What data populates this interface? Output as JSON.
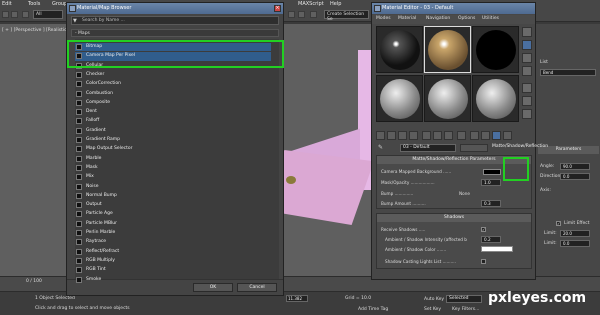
{
  "app": {
    "menubar": [
      {
        "label": "Edit"
      },
      {
        "label": "Tools"
      },
      {
        "label": "Group"
      },
      {
        "label": "MAXScript"
      },
      {
        "label": "Help"
      }
    ],
    "selection_filter": "All",
    "selection_set_placeholder": "Create Selection Se",
    "viewport_label": "[ + ] [Perspective ] [Realistic ]",
    "timeline": {
      "frame_readout": "0 / 100"
    },
    "status": {
      "objects_selected": "1 Object Selected",
      "prompt": "Click and drag to select and move objects",
      "y_value": "11.382",
      "grid": "Grid = 10.0",
      "add_time_tag": "Add Time Tag",
      "auto_key": "Auto Key",
      "auto_key_value": "Selected",
      "set_key": "Set Key",
      "key_filters": "Key Filters..."
    },
    "command_panel": {
      "list_label": "List",
      "bend_label": "Bend",
      "parameters_header": "Parameters",
      "angle_label": "Angle:",
      "angle_value": "90.0",
      "direction_label": "Direction:",
      "direction_value": "0.0",
      "axis_label": "Axis:",
      "limit_effect_label": "Limit Effect",
      "upper_limit_label": "Limit:",
      "upper_limit_value": "20.0",
      "lower_limit_label": "Limit:",
      "lower_limit_value": "0.0"
    }
  },
  "browser": {
    "title": "Material/Map Browser",
    "search_placeholder": "Search by Name ...",
    "group_label": "- Maps",
    "items": [
      {
        "label": "Bitmap",
        "selected": true
      },
      {
        "label": "Camera Map Per Pixel",
        "selected": true
      },
      {
        "label": "Cellular",
        "selected": false
      },
      {
        "label": "Checker",
        "selected": false
      },
      {
        "label": "ColorCorrection",
        "selected": false
      },
      {
        "label": "Combustion",
        "selected": false
      },
      {
        "label": "Composite",
        "selected": false
      },
      {
        "label": "Dent",
        "selected": false
      },
      {
        "label": "Falloff",
        "selected": false
      },
      {
        "label": "Gradient",
        "selected": false
      },
      {
        "label": "Gradient Ramp",
        "selected": false
      },
      {
        "label": "Map Output Selector",
        "selected": false
      },
      {
        "label": "Marble",
        "selected": false
      },
      {
        "label": "Mask",
        "selected": false
      },
      {
        "label": "Mix",
        "selected": false
      },
      {
        "label": "Noise",
        "selected": false
      },
      {
        "label": "Normal Bump",
        "selected": false
      },
      {
        "label": "Output",
        "selected": false
      },
      {
        "label": "Particle Age",
        "selected": false
      },
      {
        "label": "Particle MBlur",
        "selected": false
      },
      {
        "label": "Perlin Marble",
        "selected": false
      },
      {
        "label": "Raytrace",
        "selected": false
      },
      {
        "label": "Reflect/Refract",
        "selected": false
      },
      {
        "label": "RGB Multiply",
        "selected": false
      },
      {
        "label": "RGB Tint",
        "selected": false
      },
      {
        "label": "Smoke",
        "selected": false
      }
    ],
    "ok_label": "OK",
    "cancel_label": "Cancel"
  },
  "editor": {
    "title": "Material Editor - 03 - Default",
    "menu": [
      {
        "label": "Modes"
      },
      {
        "label": "Material"
      },
      {
        "label": "Navigation"
      },
      {
        "label": "Options"
      },
      {
        "label": "Utilities"
      }
    ],
    "material_name": "03 - Default",
    "material_type": "Matte/Shadow/Reflection",
    "rollout_params_title": "Matte/Shadow/Reflection Parameters",
    "camera_mapped_bg_label": "Camera Mapped Background ......",
    "mask_opacity_label": "Mask/Opacity ..................",
    "mask_opacity_value": "1.0",
    "bump_label": "Bump ..............",
    "bump_value": "None",
    "bump_amount_label": "Bump Amount ..........",
    "bump_amount_value": "0.3",
    "rollout_shadows_title": "Shadows",
    "receive_shadows_label": "Receive Shadows .....",
    "ambient_intensity_label": "Ambient / Shadow Intensity (affected b",
    "ambient_intensity_value": "0.2",
    "ambient_color_label": "Ambient / Shadow Color .......",
    "shadow_lights_label": "Shadow Casting Lights List ..........",
    "checkmark": "✓"
  },
  "watermark": "pxleyes.com",
  "colors": {
    "highlight_green": "#22d022",
    "selected_row": "#305d8c",
    "scene_pink": "#e6b8e6"
  }
}
